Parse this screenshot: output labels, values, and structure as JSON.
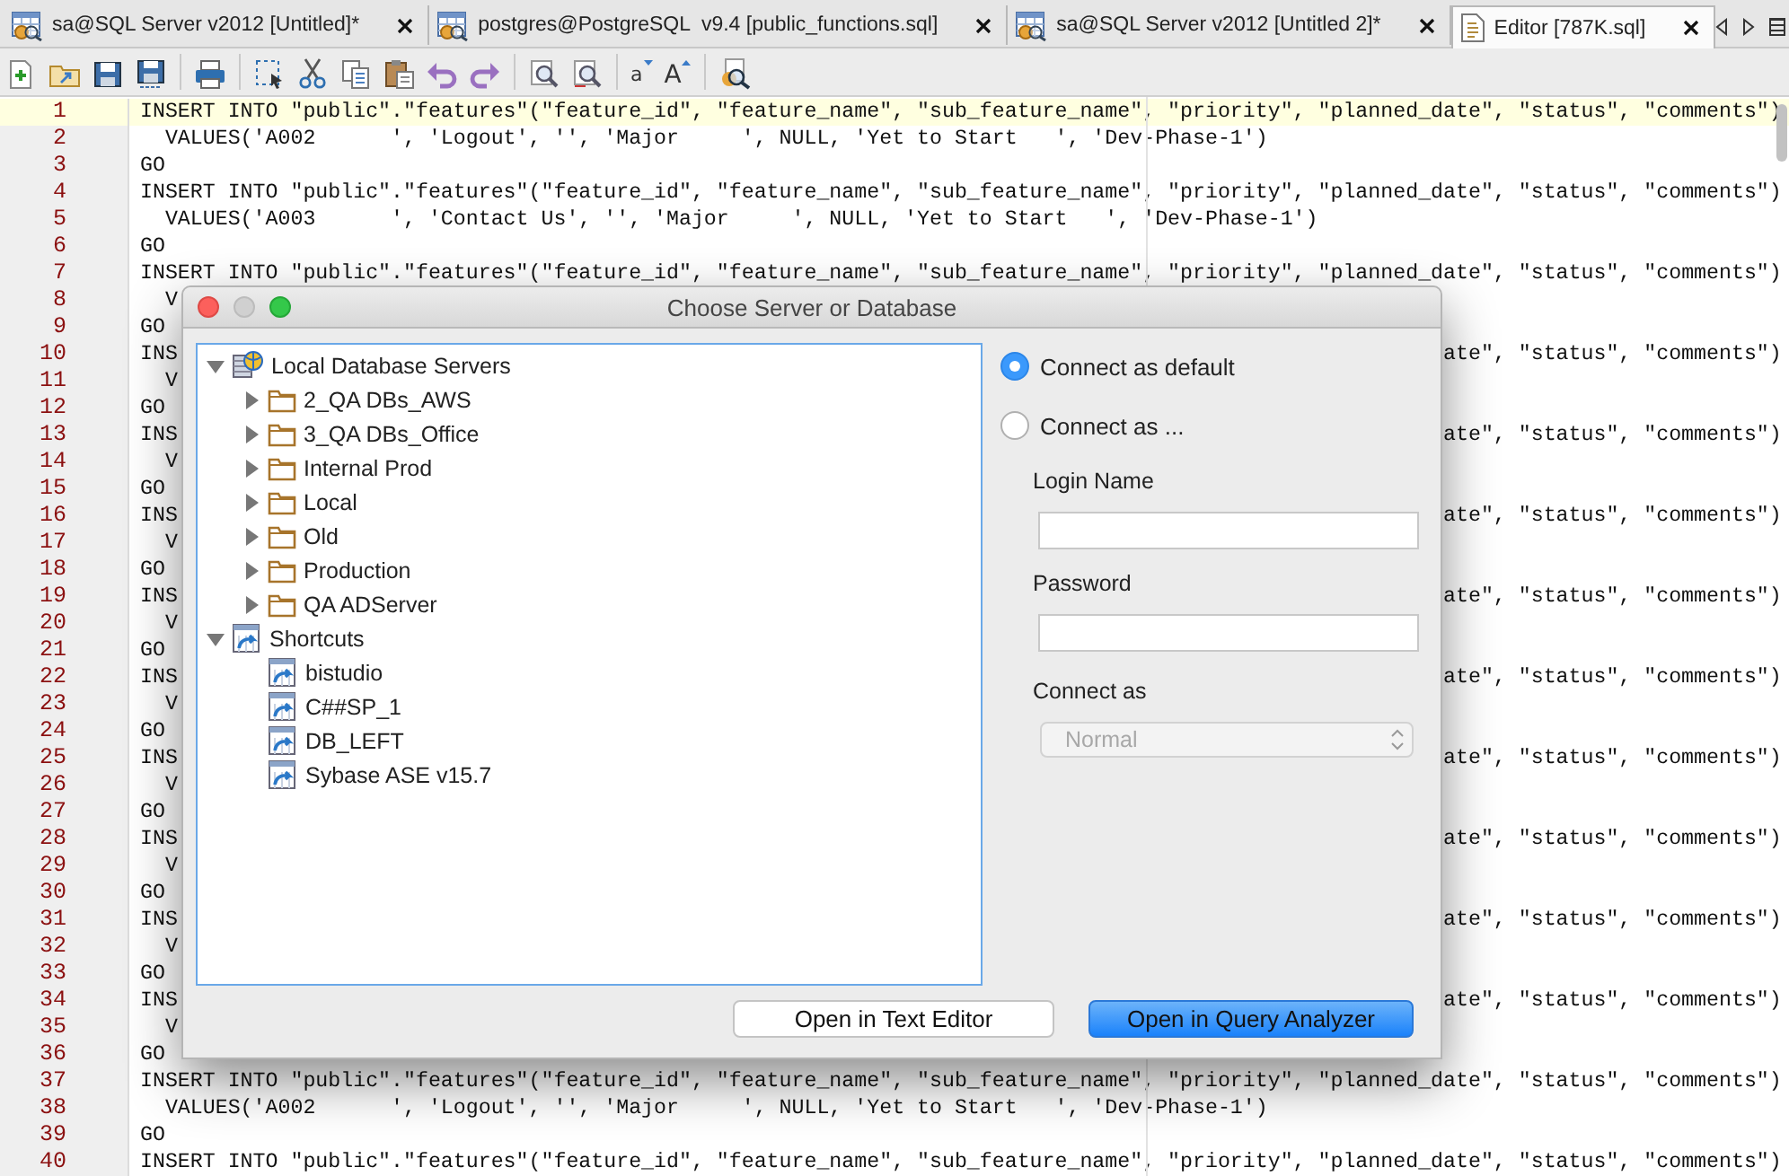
{
  "tabs": [
    {
      "kind": "query",
      "label": "sa@SQL Server v2012 [Untitled]*",
      "selected": false
    },
    {
      "kind": "query",
      "label": "postgres@PostgreSQL  v9.4 [public_functions.sql]",
      "selected": false
    },
    {
      "kind": "query",
      "label": "sa@SQL Server v2012 [Untitled 2]*",
      "selected": false
    },
    {
      "kind": "editor",
      "label": "Editor [787K.sql]",
      "selected": true
    }
  ],
  "toolbar": [
    {
      "kind": "new-file"
    },
    {
      "kind": "open-file"
    },
    {
      "kind": "save"
    },
    {
      "kind": "save-all"
    },
    {
      "kind": "separator"
    },
    {
      "kind": "print"
    },
    {
      "kind": "separator"
    },
    {
      "kind": "select"
    },
    {
      "kind": "cut"
    },
    {
      "kind": "copy"
    },
    {
      "kind": "paste"
    },
    {
      "kind": "undo"
    },
    {
      "kind": "redo"
    },
    {
      "kind": "separator"
    },
    {
      "kind": "find"
    },
    {
      "kind": "find-next"
    },
    {
      "kind": "separator"
    },
    {
      "kind": "font-smaller",
      "label": "a"
    },
    {
      "kind": "font-larger",
      "label": "A"
    },
    {
      "kind": "separator"
    },
    {
      "kind": "query-builder"
    }
  ],
  "editor": {
    "lines": [
      {
        "number": "1",
        "kind": "full",
        "current": true,
        "text": "INSERT INTO \"public\".\"features\"(\"feature_id\", \"feature_name\", \"sub_feature_name\", \"priority\", \"planned_date\", \"status\", \"comments\")"
      },
      {
        "number": "2",
        "kind": "full",
        "current": false,
        "text": "  VALUES('A002      ', 'Logout', '', 'Major     ', NULL, 'Yet to Start   ', 'Dev-Phase-1')"
      },
      {
        "number": "3",
        "kind": "full",
        "current": false,
        "text": "GO"
      },
      {
        "number": "4",
        "kind": "full",
        "current": false,
        "text": "INSERT INTO \"public\".\"features\"(\"feature_id\", \"feature_name\", \"sub_feature_name\", \"priority\", \"planned_date\", \"status\", \"comments\")"
      },
      {
        "number": "5",
        "kind": "full",
        "current": false,
        "text": "  VALUES('A003      ', 'Contact Us', '', 'Major     ', NULL, 'Yet to Start   ', 'Dev-Phase-1')"
      },
      {
        "number": "6",
        "kind": "full",
        "current": false,
        "text": "GO"
      },
      {
        "number": "7",
        "kind": "full",
        "current": false,
        "text": "INSERT INTO \"public\".\"features\"(\"feature_id\", \"feature_name\", \"sub_feature_name\", \"priority\", \"planned_date\", \"status\", \"comments\")"
      },
      {
        "number": "8",
        "kind": "covered",
        "current": false,
        "left": "  V"
      },
      {
        "number": "9",
        "kind": "covered",
        "current": false,
        "left": "GO"
      },
      {
        "number": "10",
        "kind": "covered",
        "current": false,
        "left": "INS",
        "right": "ate\", \"status\", \"comments\")"
      },
      {
        "number": "11",
        "kind": "covered",
        "current": false,
        "left": "  V"
      },
      {
        "number": "12",
        "kind": "covered",
        "current": false,
        "left": "GO"
      },
      {
        "number": "13",
        "kind": "covered",
        "current": false,
        "left": "INS",
        "right": "ate\", \"status\", \"comments\")"
      },
      {
        "number": "14",
        "kind": "covered",
        "current": false,
        "left": "  V"
      },
      {
        "number": "15",
        "kind": "covered",
        "current": false,
        "left": "GO"
      },
      {
        "number": "16",
        "kind": "covered",
        "current": false,
        "left": "INS",
        "right": "ate\", \"status\", \"comments\")"
      },
      {
        "number": "17",
        "kind": "covered",
        "current": false,
        "left": "  V"
      },
      {
        "number": "18",
        "kind": "covered",
        "current": false,
        "left": "GO"
      },
      {
        "number": "19",
        "kind": "covered",
        "current": false,
        "left": "INS",
        "right": "ate\", \"status\", \"comments\")"
      },
      {
        "number": "20",
        "kind": "covered",
        "current": false,
        "left": "  V"
      },
      {
        "number": "21",
        "kind": "covered",
        "current": false,
        "left": "GO"
      },
      {
        "number": "22",
        "kind": "covered",
        "current": false,
        "left": "INS",
        "right": "ate\", \"status\", \"comments\")"
      },
      {
        "number": "23",
        "kind": "covered",
        "current": false,
        "left": "  V"
      },
      {
        "number": "24",
        "kind": "covered",
        "current": false,
        "left": "GO"
      },
      {
        "number": "25",
        "kind": "covered",
        "current": false,
        "left": "INS",
        "right": "ate\", \"status\", \"comments\")"
      },
      {
        "number": "26",
        "kind": "covered",
        "current": false,
        "left": "  V"
      },
      {
        "number": "27",
        "kind": "covered",
        "current": false,
        "left": "GO"
      },
      {
        "number": "28",
        "kind": "covered",
        "current": false,
        "left": "INS",
        "right": "ate\", \"status\", \"comments\")"
      },
      {
        "number": "29",
        "kind": "covered",
        "current": false,
        "left": "  V"
      },
      {
        "number": "30",
        "kind": "covered",
        "current": false,
        "left": "GO"
      },
      {
        "number": "31",
        "kind": "covered",
        "current": false,
        "left": "INS",
        "right": "ate\", \"status\", \"comments\")"
      },
      {
        "number": "32",
        "kind": "covered",
        "current": false,
        "left": "  V"
      },
      {
        "number": "33",
        "kind": "covered",
        "current": false,
        "left": "GO"
      },
      {
        "number": "34",
        "kind": "covered",
        "current": false,
        "left": "INS",
        "right": "ate\", \"status\", \"comments\")"
      },
      {
        "number": "35",
        "kind": "covered",
        "current": false,
        "left": "  V"
      },
      {
        "number": "36",
        "kind": "covered",
        "current": false,
        "left": "GO"
      },
      {
        "number": "37",
        "kind": "full",
        "current": false,
        "text": "INSERT INTO \"public\".\"features\"(\"feature_id\", \"feature_name\", \"sub_feature_name\", \"priority\", \"planned_date\", \"status\", \"comments\")"
      },
      {
        "number": "38",
        "kind": "full",
        "current": false,
        "text": "  VALUES('A002      ', 'Logout', '', 'Major     ', NULL, 'Yet to Start   ', 'Dev-Phase-1')"
      },
      {
        "number": "39",
        "kind": "full",
        "current": false,
        "text": "GO"
      },
      {
        "number": "40",
        "kind": "full",
        "current": false,
        "text": "INSERT INTO \"public\".\"features\"(\"feature_id\", \"feature_name\", \"sub_feature_name\", \"priority\", \"planned_date\", \"status\", \"comments\")"
      }
    ]
  },
  "dialog": {
    "title": "Choose Server or Database",
    "tree": [
      {
        "kind": "server-group",
        "label": "Local Database Servers",
        "expanded": true,
        "children": [
          {
            "kind": "folder",
            "label": "2_QA DBs_AWS",
            "expanded": false
          },
          {
            "kind": "folder",
            "label": "3_QA DBs_Office",
            "expanded": false
          },
          {
            "kind": "folder",
            "label": "Internal Prod",
            "expanded": false
          },
          {
            "kind": "folder",
            "label": "Local",
            "expanded": false
          },
          {
            "kind": "folder",
            "label": "Old",
            "expanded": false
          },
          {
            "kind": "folder",
            "label": "Production",
            "expanded": false
          },
          {
            "kind": "folder",
            "label": "QA ADServer",
            "expanded": false
          }
        ]
      },
      {
        "kind": "shortcut-group",
        "label": "Shortcuts",
        "expanded": true,
        "children": [
          {
            "kind": "shortcut",
            "label": "bistudio"
          },
          {
            "kind": "shortcut",
            "label": "C##SP_1"
          },
          {
            "kind": "shortcut",
            "label": "DB_LEFT"
          },
          {
            "kind": "shortcut",
            "label": "Sybase ASE v15.7"
          }
        ]
      }
    ],
    "options": [
      {
        "label": "Connect as default",
        "selected": true
      },
      {
        "label": "Connect as ...",
        "selected": false
      }
    ],
    "fields": [
      {
        "label": "Login Name"
      },
      {
        "label": "Password"
      }
    ],
    "connect_as": {
      "label": "Connect as",
      "value": "Normal",
      "disabled": true
    },
    "buttons": [
      {
        "label": "Open in Text Editor",
        "default": false
      },
      {
        "label": "Open in Query Analyzer",
        "default": true
      }
    ]
  }
}
